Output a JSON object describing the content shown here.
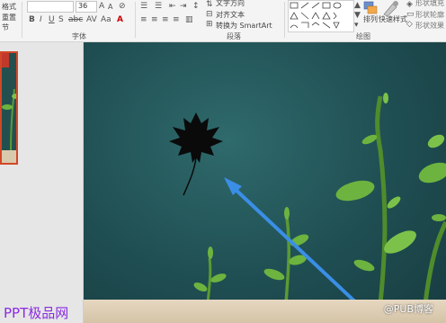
{
  "ribbon": {
    "row1": {
      "format_partial": "格式",
      "font_size": "36",
      "text_direction": "文字方向",
      "quick_styles_partial": "形状填充"
    },
    "row2": {
      "reset_partial": "重置",
      "align_text": "对齐文本",
      "arrange": "排列",
      "quick_styles": "快速样式",
      "shape_outline": "形状轮廓"
    },
    "row3": {
      "section_partial": "节",
      "convert_smartart": "转换为 SmartArt",
      "shape_effects": "形状效果"
    },
    "groups": {
      "font": "字体",
      "paragraph": "段落",
      "drawing": "绘图"
    }
  },
  "watermark": "PPT极品网",
  "slide": {
    "credit": "@PUB博客"
  },
  "colors": {
    "slide_bg": "#1f4e52",
    "arrow": "#3a8ee6",
    "selected_thumb_border": "#d24726",
    "watermark": "#8a2be2"
  }
}
